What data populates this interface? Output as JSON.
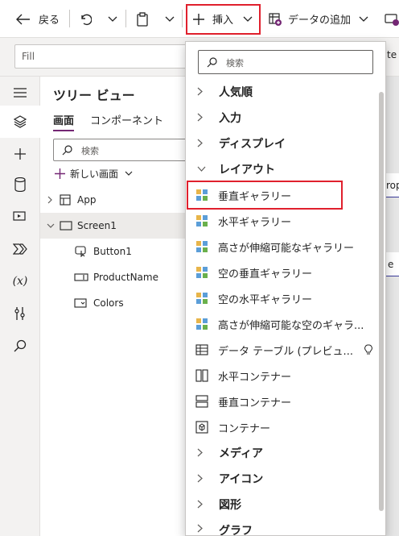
{
  "toolbar": {
    "back_label": "戻る",
    "insert_label": "挿入",
    "add_data_label": "データの追加",
    "partial_right_text": "te"
  },
  "formula": {
    "property": "Fill"
  },
  "tree": {
    "title": "ツリー ビュー",
    "tabs": [
      "画面",
      "コンポーネント"
    ],
    "search_placeholder": "検索",
    "new_screen": "新しい画面",
    "items": [
      "App",
      "Screen1",
      "Button1",
      "ProductName",
      "Colors"
    ]
  },
  "canvas_fragments": {
    "a": "rop",
    "b": "e"
  },
  "insert_menu": {
    "search_placeholder": "検索",
    "categories": [
      "人気順",
      "入力",
      "ディスプレイ",
      "レイアウト",
      "メディア",
      "アイコン",
      "図形",
      "グラフ"
    ],
    "layout_items": [
      {
        "label": "垂直ギャラリー",
        "icon": "vertical-gallery-icon"
      },
      {
        "label": "水平ギャラリー",
        "icon": "horizontal-gallery-icon"
      },
      {
        "label": "高さが伸縮可能なギャラリー",
        "icon": "flexible-height-gallery-icon"
      },
      {
        "label": "空の垂直ギャラリー",
        "icon": "blank-vertical-gallery-icon"
      },
      {
        "label": "空の水平ギャラリー",
        "icon": "blank-horizontal-gallery-icon"
      },
      {
        "label": "高さが伸縮可能な空のギャラ...",
        "icon": "blank-flexible-gallery-icon"
      },
      {
        "label": "データ テーブル (プレビュ...",
        "icon": "data-table-icon"
      },
      {
        "label": "水平コンテナー",
        "icon": "horizontal-container-icon"
      },
      {
        "label": "垂直コンテナー",
        "icon": "vertical-container-icon"
      },
      {
        "label": "コンテナー",
        "icon": "container-icon"
      }
    ]
  },
  "colors": {
    "highlight": "#e0202d",
    "accent": "#742774"
  }
}
